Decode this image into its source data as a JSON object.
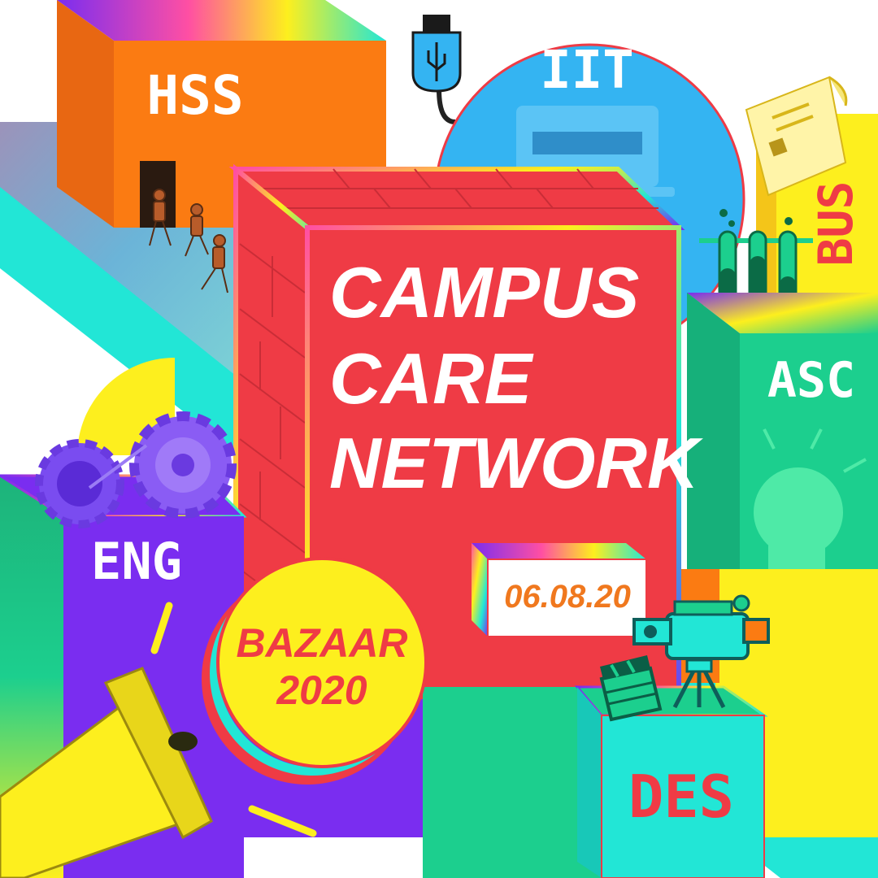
{
  "poster": {
    "title_lines": [
      "CAMPUS",
      "CARE",
      "NETWORK"
    ],
    "date": "06.08.20",
    "badge_lines": [
      "BAZAAR",
      "2020"
    ]
  },
  "buildings": {
    "hss": "HSS",
    "iit": "IIT",
    "bus": "BUS",
    "asc": "ASC",
    "eng": "ENG",
    "des": "DES"
  },
  "colors": {
    "main_block": "#ef3b45",
    "hss_block": "#fb7b12",
    "iit_dome": "#34b4f2",
    "asc_block": "#1ccf8e",
    "eng_block": "#7a2df0",
    "des_block": "#22e6d6",
    "bus_block": "#fdef1e",
    "badge": "#fdef1e",
    "date_text": "#f0781e",
    "title_text": "#ffffff"
  },
  "icons": [
    "usb-cable-icon",
    "laptop-icon",
    "receipt-icon",
    "test-tubes-icon",
    "lightbulb-icon",
    "gears-icon",
    "megaphone-icon",
    "video-camera-icon",
    "clapperboard-icon",
    "people-walking-icon"
  ]
}
